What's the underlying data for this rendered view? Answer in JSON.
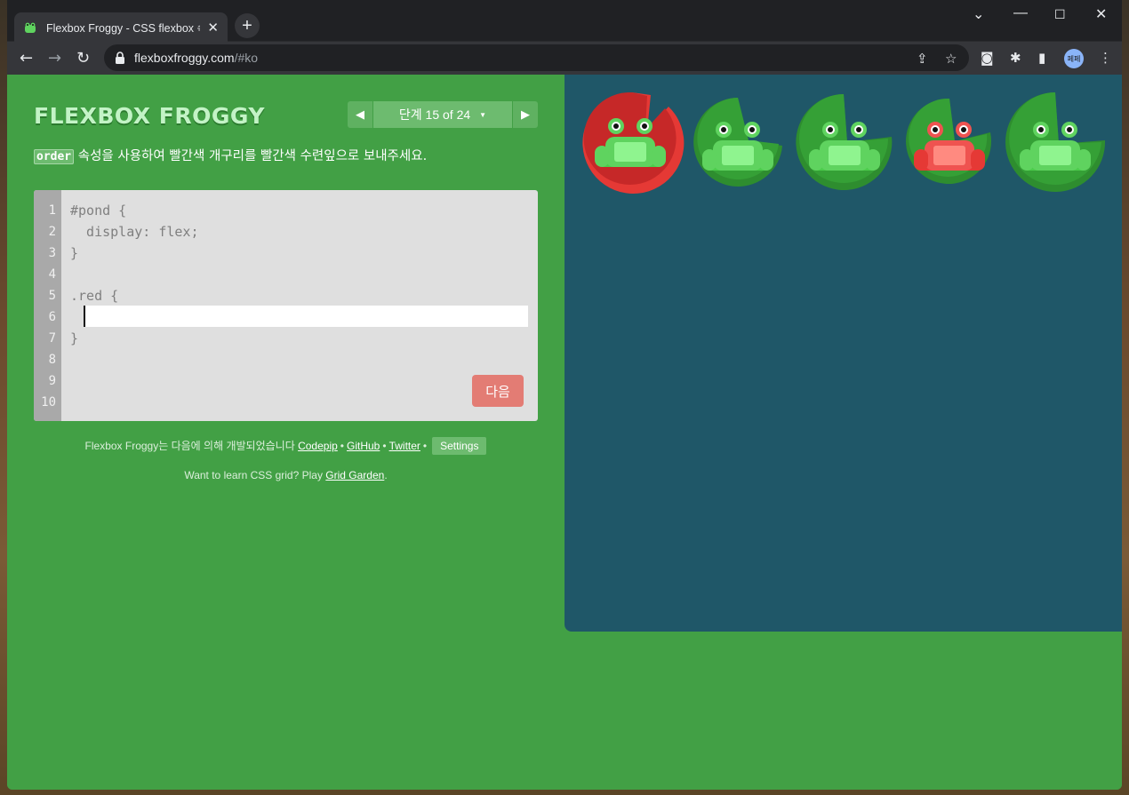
{
  "browser": {
    "tab_title": "Flexbox Froggy - CSS flexbox 속",
    "url_host": "flexboxfroggy.com",
    "url_path": "/#ko",
    "avatar_text": "페페",
    "new_tab_label": "+",
    "tab_close_label": "✕"
  },
  "header": {
    "logo": "FLEXBOX FROGGY",
    "level_label": "단계 15 of 24",
    "prev_arrow": "◀",
    "next_arrow": "▶",
    "caret": "▼"
  },
  "instructions": {
    "keyword": "order",
    "text": " 속성을 사용하여 빨간색 개구리를 빨간색 수련잎으로 보내주세요."
  },
  "editor": {
    "line_numbers": [
      "1",
      "2",
      "3",
      "4",
      "5",
      "6",
      "7",
      "8",
      "9",
      "10"
    ],
    "lines": [
      "#pond {",
      "  display: flex;",
      "}",
      "",
      ".red {",
      "",
      "}",
      "",
      "",
      ""
    ],
    "input_value": "",
    "next_button": "다음"
  },
  "footer": {
    "credits_prefix": "Flexbox Froggy는 다음에 의해 개발되었습니다 ",
    "codepip": "Codepip",
    "github": "GitHub",
    "twitter": "Twitter",
    "bullet": "•",
    "settings": "Settings",
    "promo_prefix": "Want to learn CSS grid? Play ",
    "promo_link": "Grid Garden",
    "promo_suffix": "."
  },
  "pond": {
    "lilypads": [
      "red",
      "green",
      "green",
      "green",
      "green"
    ],
    "frogs": [
      "green",
      "green",
      "green",
      "red",
      "green"
    ]
  },
  "colors": {
    "page_bg": "#42a045",
    "pond_bg": "#1f5768",
    "red_pad": "#d32525",
    "green_pad": "#2e8d2f",
    "green_frog": "#5fd35f",
    "red_frog": "#ef5350",
    "next_button": "#e37c74"
  }
}
